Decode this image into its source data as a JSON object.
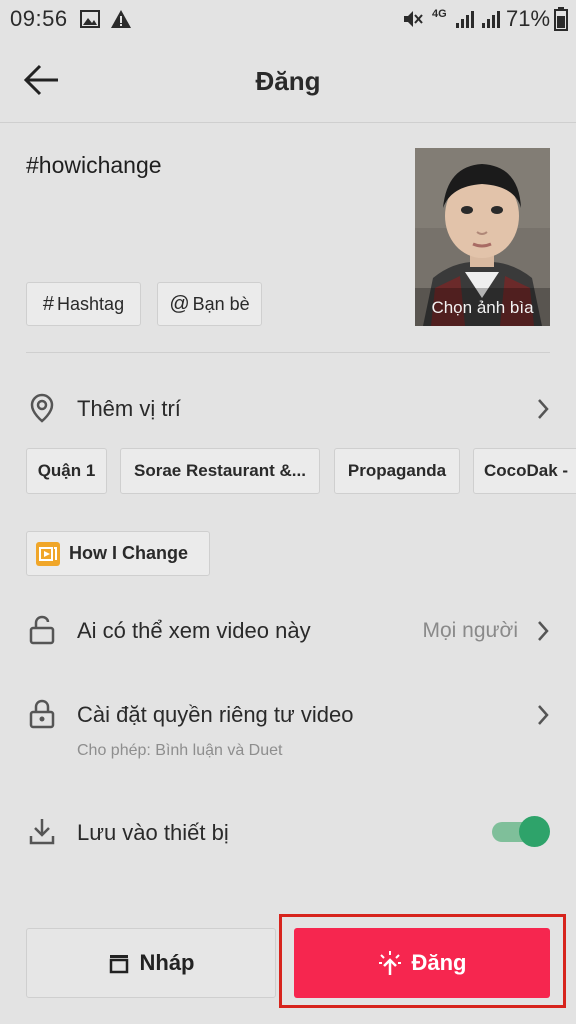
{
  "status_bar": {
    "time": "09:56",
    "network": "4G",
    "battery": "71%",
    "icons": [
      "image-icon",
      "warning-icon",
      "mute-icon",
      "signal-icon",
      "battery-icon"
    ]
  },
  "header": {
    "title": "Đăng",
    "back_icon": "arrow-left-icon"
  },
  "caption": {
    "text": "#howichange"
  },
  "cover": {
    "label": "Chọn ảnh bìa"
  },
  "chips": {
    "hashtag_symbol": "#",
    "hashtag_label": "Hashtag",
    "friends_symbol": "@",
    "friends_label": "Bạn bè"
  },
  "location": {
    "label": "Thêm vị trí",
    "suggestions": [
      "Quận 1",
      "Sorae Restaurant &...",
      "Propaganda",
      "CocoDak -"
    ]
  },
  "effect": {
    "label": "How I Change"
  },
  "visibility": {
    "label": "Ai có thể xem video này",
    "value": "Mọi người"
  },
  "privacy": {
    "label": "Cài đặt quyền riêng tư video",
    "sub": "Cho phép: Bình luận và Duet"
  },
  "save_device": {
    "label": "Lưu vào thiết bị",
    "enabled": true
  },
  "actions": {
    "draft_label": "Nháp",
    "post_label": "Đăng"
  },
  "colors": {
    "accent": "#f6264f",
    "toggle_on": "#2ea36a",
    "highlight_border": "#d7241d"
  }
}
